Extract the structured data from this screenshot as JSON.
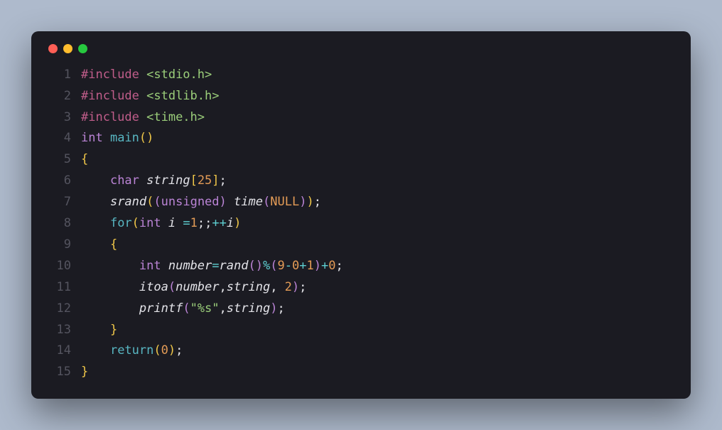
{
  "window": {
    "dots": [
      "red",
      "yellow",
      "green"
    ]
  },
  "code": {
    "lines": [
      {
        "n": "1",
        "tokens": [
          {
            "t": "#include ",
            "c": "tok-directive"
          },
          {
            "t": "<stdio.h>",
            "c": "tok-string"
          }
        ]
      },
      {
        "n": "2",
        "tokens": [
          {
            "t": "#include ",
            "c": "tok-directive"
          },
          {
            "t": "<stdlib.h>",
            "c": "tok-string"
          }
        ]
      },
      {
        "n": "3",
        "tokens": [
          {
            "t": "#include ",
            "c": "tok-directive"
          },
          {
            "t": "<time.h>",
            "c": "tok-string"
          }
        ]
      },
      {
        "n": "4",
        "tokens": [
          {
            "t": "int ",
            "c": "tok-keyword"
          },
          {
            "t": "main",
            "c": "tok-fn"
          },
          {
            "t": "()",
            "c": "tok-paren"
          }
        ]
      },
      {
        "n": "5",
        "tokens": [
          {
            "t": "{",
            "c": "tok-paren"
          }
        ]
      },
      {
        "n": "6",
        "tokens": [
          {
            "t": "    ",
            "c": ""
          },
          {
            "t": "char ",
            "c": "tok-keyword"
          },
          {
            "t": "string",
            "c": "tok-ident"
          },
          {
            "t": "[",
            "c": "tok-paren"
          },
          {
            "t": "25",
            "c": "tok-num"
          },
          {
            "t": "]",
            "c": "tok-paren"
          },
          {
            "t": ";",
            "c": "tok-punct"
          }
        ]
      },
      {
        "n": "7",
        "tokens": [
          {
            "t": "    ",
            "c": ""
          },
          {
            "t": "srand",
            "c": "tok-ident"
          },
          {
            "t": "(",
            "c": "tok-paren"
          },
          {
            "t": "(",
            "c": "tok-paren2"
          },
          {
            "t": "unsigned",
            "c": "tok-keyword"
          },
          {
            "t": ")",
            "c": "tok-paren2"
          },
          {
            "t": " ",
            "c": ""
          },
          {
            "t": "time",
            "c": "tok-ident"
          },
          {
            "t": "(",
            "c": "tok-paren2"
          },
          {
            "t": "NULL",
            "c": "tok-const"
          },
          {
            "t": ")",
            "c": "tok-paren2"
          },
          {
            "t": ")",
            "c": "tok-paren"
          },
          {
            "t": ";",
            "c": "tok-punct"
          }
        ]
      },
      {
        "n": "8",
        "tokens": [
          {
            "t": "    ",
            "c": ""
          },
          {
            "t": "for",
            "c": "tok-fn"
          },
          {
            "t": "(",
            "c": "tok-paren"
          },
          {
            "t": "int ",
            "c": "tok-keyword"
          },
          {
            "t": "i",
            "c": "tok-ident"
          },
          {
            "t": " ",
            "c": ""
          },
          {
            "t": "=",
            "c": "tok-op"
          },
          {
            "t": "1",
            "c": "tok-num"
          },
          {
            "t": ";;",
            "c": "tok-punct"
          },
          {
            "t": "++",
            "c": "tok-op"
          },
          {
            "t": "i",
            "c": "tok-ident"
          },
          {
            "t": ")",
            "c": "tok-paren"
          }
        ]
      },
      {
        "n": "9",
        "tokens": [
          {
            "t": "    ",
            "c": ""
          },
          {
            "t": "{",
            "c": "tok-paren"
          }
        ]
      },
      {
        "n": "10",
        "tokens": [
          {
            "t": "        ",
            "c": ""
          },
          {
            "t": "int ",
            "c": "tok-keyword"
          },
          {
            "t": "number",
            "c": "tok-ident"
          },
          {
            "t": "=",
            "c": "tok-op"
          },
          {
            "t": "rand",
            "c": "tok-ident"
          },
          {
            "t": "(",
            "c": "tok-paren2"
          },
          {
            "t": ")",
            "c": "tok-paren2"
          },
          {
            "t": "%",
            "c": "tok-op"
          },
          {
            "t": "(",
            "c": "tok-paren2"
          },
          {
            "t": "9",
            "c": "tok-num"
          },
          {
            "t": "-",
            "c": "tok-op"
          },
          {
            "t": "0",
            "c": "tok-num"
          },
          {
            "t": "+",
            "c": "tok-op"
          },
          {
            "t": "1",
            "c": "tok-num"
          },
          {
            "t": ")",
            "c": "tok-paren2"
          },
          {
            "t": "+",
            "c": "tok-op"
          },
          {
            "t": "0",
            "c": "tok-num"
          },
          {
            "t": ";",
            "c": "tok-punct"
          }
        ]
      },
      {
        "n": "11",
        "tokens": [
          {
            "t": "        ",
            "c": ""
          },
          {
            "t": "itoa",
            "c": "tok-ident"
          },
          {
            "t": "(",
            "c": "tok-paren2"
          },
          {
            "t": "number",
            "c": "tok-ident"
          },
          {
            "t": ",",
            "c": "tok-punct"
          },
          {
            "t": "string",
            "c": "tok-ident"
          },
          {
            "t": ", ",
            "c": "tok-punct"
          },
          {
            "t": "2",
            "c": "tok-num"
          },
          {
            "t": ")",
            "c": "tok-paren2"
          },
          {
            "t": ";",
            "c": "tok-punct"
          }
        ]
      },
      {
        "n": "12",
        "tokens": [
          {
            "t": "        ",
            "c": ""
          },
          {
            "t": "printf",
            "c": "tok-ident"
          },
          {
            "t": "(",
            "c": "tok-paren2"
          },
          {
            "t": "\"%s\"",
            "c": "tok-string"
          },
          {
            "t": ",",
            "c": "tok-punct"
          },
          {
            "t": "string",
            "c": "tok-ident"
          },
          {
            "t": ")",
            "c": "tok-paren2"
          },
          {
            "t": ";",
            "c": "tok-punct"
          }
        ]
      },
      {
        "n": "13",
        "tokens": [
          {
            "t": "    ",
            "c": ""
          },
          {
            "t": "}",
            "c": "tok-paren"
          }
        ]
      },
      {
        "n": "14",
        "tokens": [
          {
            "t": "    ",
            "c": ""
          },
          {
            "t": "return",
            "c": "tok-fn"
          },
          {
            "t": "(",
            "c": "tok-paren"
          },
          {
            "t": "0",
            "c": "tok-num"
          },
          {
            "t": ")",
            "c": "tok-paren"
          },
          {
            "t": ";",
            "c": "tok-punct"
          }
        ]
      },
      {
        "n": "15",
        "tokens": [
          {
            "t": "}",
            "c": "tok-paren"
          }
        ]
      }
    ]
  }
}
